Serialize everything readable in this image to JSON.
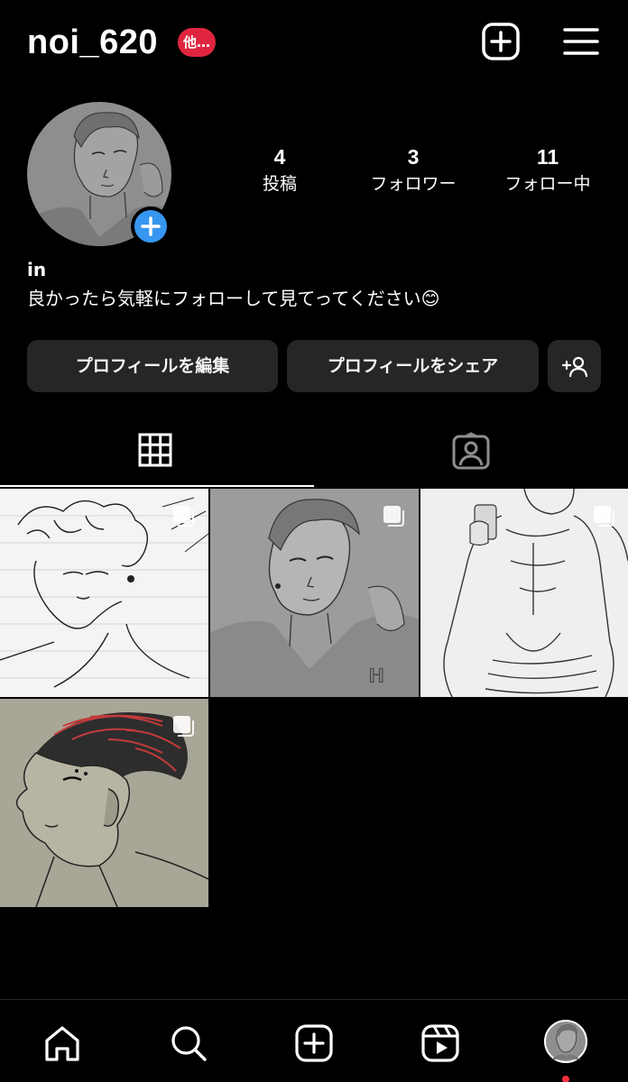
{
  "header": {
    "username": "noi_620",
    "badge": "他…",
    "badge_color": "#e0263e",
    "icons": [
      "new-post-icon",
      "menu-icon"
    ]
  },
  "profile": {
    "stats": [
      {
        "value": "4",
        "label": "投稿"
      },
      {
        "value": "3",
        "label": "フォロワー"
      },
      {
        "value": "11",
        "label": "フォロー中"
      }
    ],
    "bio_name": "in",
    "bio_text": "良かったら気軽にフォローして見てってください😊",
    "add_story_color": "#3797f0"
  },
  "buttons": {
    "edit": "プロフィールを編集",
    "share": "プロフィールをシェア",
    "discover_icon": "add-person-icon"
  },
  "tabs": {
    "active": "grid",
    "items": [
      "grid-icon",
      "tagged-icon"
    ]
  },
  "posts": [
    {
      "type": "carousel"
    },
    {
      "type": "carousel"
    },
    {
      "type": "carousel"
    },
    {
      "type": "carousel"
    }
  ],
  "bottom_nav": {
    "items": [
      "home-icon",
      "search-icon",
      "create-icon",
      "reels-icon",
      "profile-avatar"
    ],
    "notification_dot_color": "#ff3040"
  }
}
